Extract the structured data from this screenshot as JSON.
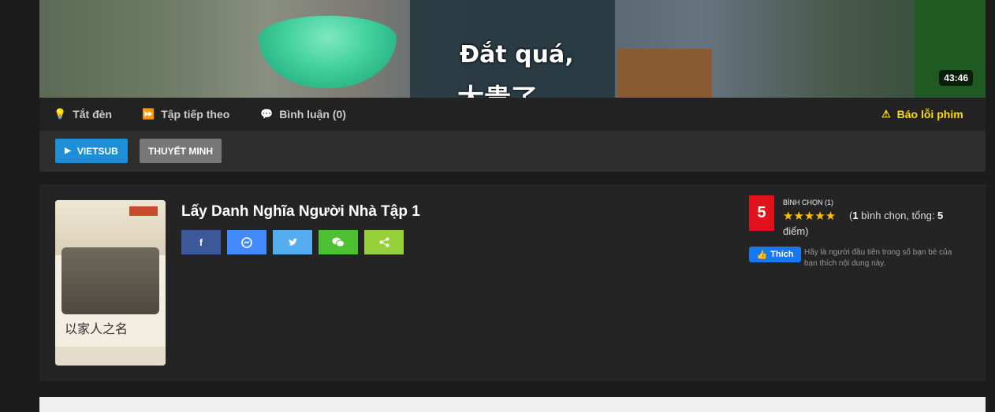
{
  "video": {
    "subtitle_line1": "Đắt quá,",
    "subtitle_line2": "太贵了",
    "duration": "43:46"
  },
  "controls": {
    "lights_off": "Tắt đèn",
    "next_episode": "Tập tiếp theo",
    "comments": "Bình luận (0)",
    "report": "Báo lỗi phim",
    "icons": [
      "lightbulb-icon",
      "fast-forward-icon",
      "comments-icon",
      "warning-icon"
    ]
  },
  "servers": {
    "active": "VIETSUB",
    "inactive": "THUYẾT MINH"
  },
  "movie": {
    "title": "Lấy Danh Nghĩa Người Nhà Tập 1",
    "poster_text": "以家人之名",
    "share_buttons": [
      "facebook",
      "messenger",
      "twitter",
      "wechat",
      "share"
    ]
  },
  "rating": {
    "score": "5",
    "label": "BÌNH CHỌN (1)",
    "stars": "★★★★★",
    "text_prefix": "(",
    "votes": "1",
    "text_mid": " bình chọn, tổng: ",
    "total": "5",
    "text_suffix": "điểm)"
  },
  "like": {
    "button": "Thích",
    "note": "Hãy là người đầu tiên trong số bạn bè của bạn thích nội dung này."
  },
  "colors": {
    "accent_blue": "#1e8fd6",
    "report_yellow": "#ffdd00",
    "rating_red": "#e0111b"
  }
}
